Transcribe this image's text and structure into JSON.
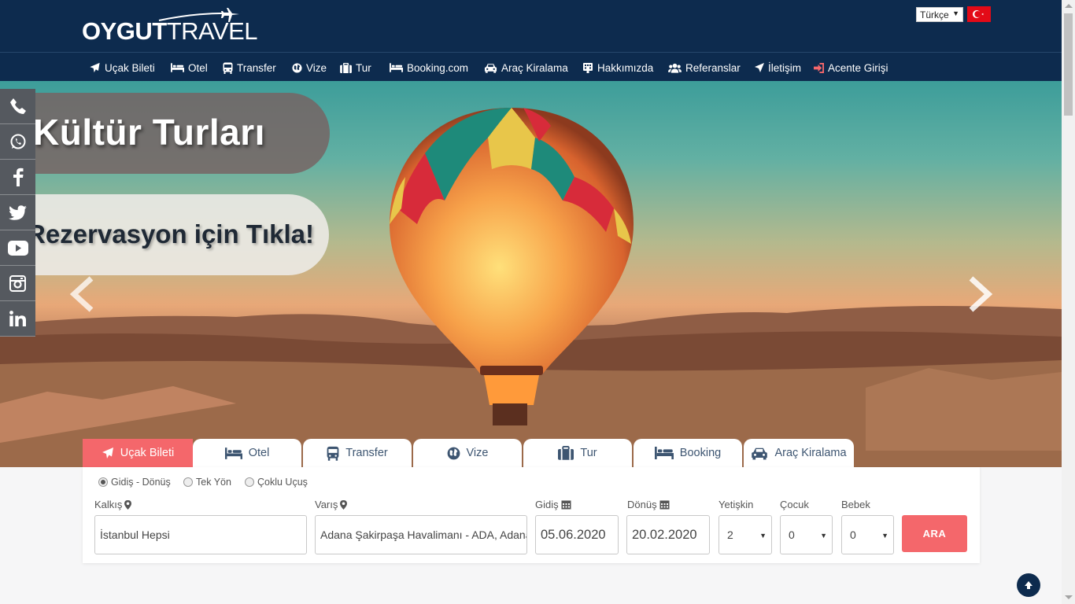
{
  "header": {
    "logo_bold": "OYGUT",
    "logo_light": "TRAVEL",
    "language": "Türkçe"
  },
  "nav": [
    {
      "label": "Uçak Bileti",
      "icon": "plane-icon"
    },
    {
      "label": "Otel",
      "icon": "bed-icon"
    },
    {
      "label": "Transfer",
      "icon": "bus-icon"
    },
    {
      "label": "Vize",
      "icon": "globe-icon"
    },
    {
      "label": "Tur",
      "icon": "suitcase-icon"
    },
    {
      "label": "Booking.com",
      "icon": "bed-icon"
    },
    {
      "label": "Araç Kiralama",
      "icon": "car-icon"
    },
    {
      "label": "Hakkımızda",
      "icon": "building-icon"
    },
    {
      "label": "Referanslar",
      "icon": "users-icon"
    },
    {
      "label": "İletişim",
      "icon": "send-icon"
    },
    {
      "label": "Acente Girişi",
      "icon": "sign-in-icon"
    }
  ],
  "slider": {
    "title": "Kültür Turları",
    "cta": "Rezervasyon için Tıkla!"
  },
  "social": [
    "phone-icon",
    "whatsapp-icon",
    "facebook-icon",
    "twitter-icon",
    "youtube-icon",
    "instagram-icon",
    "linkedin-icon"
  ],
  "tabs": [
    {
      "label": "Uçak Bileti",
      "icon": "plane-icon",
      "active": true
    },
    {
      "label": "Otel",
      "icon": "bed-icon"
    },
    {
      "label": "Transfer",
      "icon": "bus-icon"
    },
    {
      "label": "Vize",
      "icon": "globe-icon"
    },
    {
      "label": "Tur",
      "icon": "suitcase-icon"
    },
    {
      "label": "Booking",
      "icon": "bed-icon"
    },
    {
      "label": "Araç Kiralama",
      "icon": "car-icon"
    }
  ],
  "search": {
    "trip_types": [
      "Gidiş - Dönüş",
      "Tek Yön",
      "Çoklu Uçuş"
    ],
    "selected_trip_type": "Gidiş - Dönüş",
    "from_label": "Kalkış",
    "from_value": "İstanbul Hepsi",
    "to_label": "Varış",
    "to_value": "Adana Şakirpaşa Havalimanı - ADA, Adana",
    "depart_label": "Gidiş",
    "depart_value": "05.06.2020",
    "return_label": "Dönüş",
    "return_value": "20.02.2020",
    "adult_label": "Yetişkin",
    "adult_value": "2",
    "child_label": "Çocuk",
    "child_value": "0",
    "infant_label": "Bebek",
    "infant_value": "0",
    "button": "ARA"
  },
  "colors": {
    "navy": "#0d2b4e",
    "accent": "#f4676b",
    "tab_text": "#3d5571"
  }
}
